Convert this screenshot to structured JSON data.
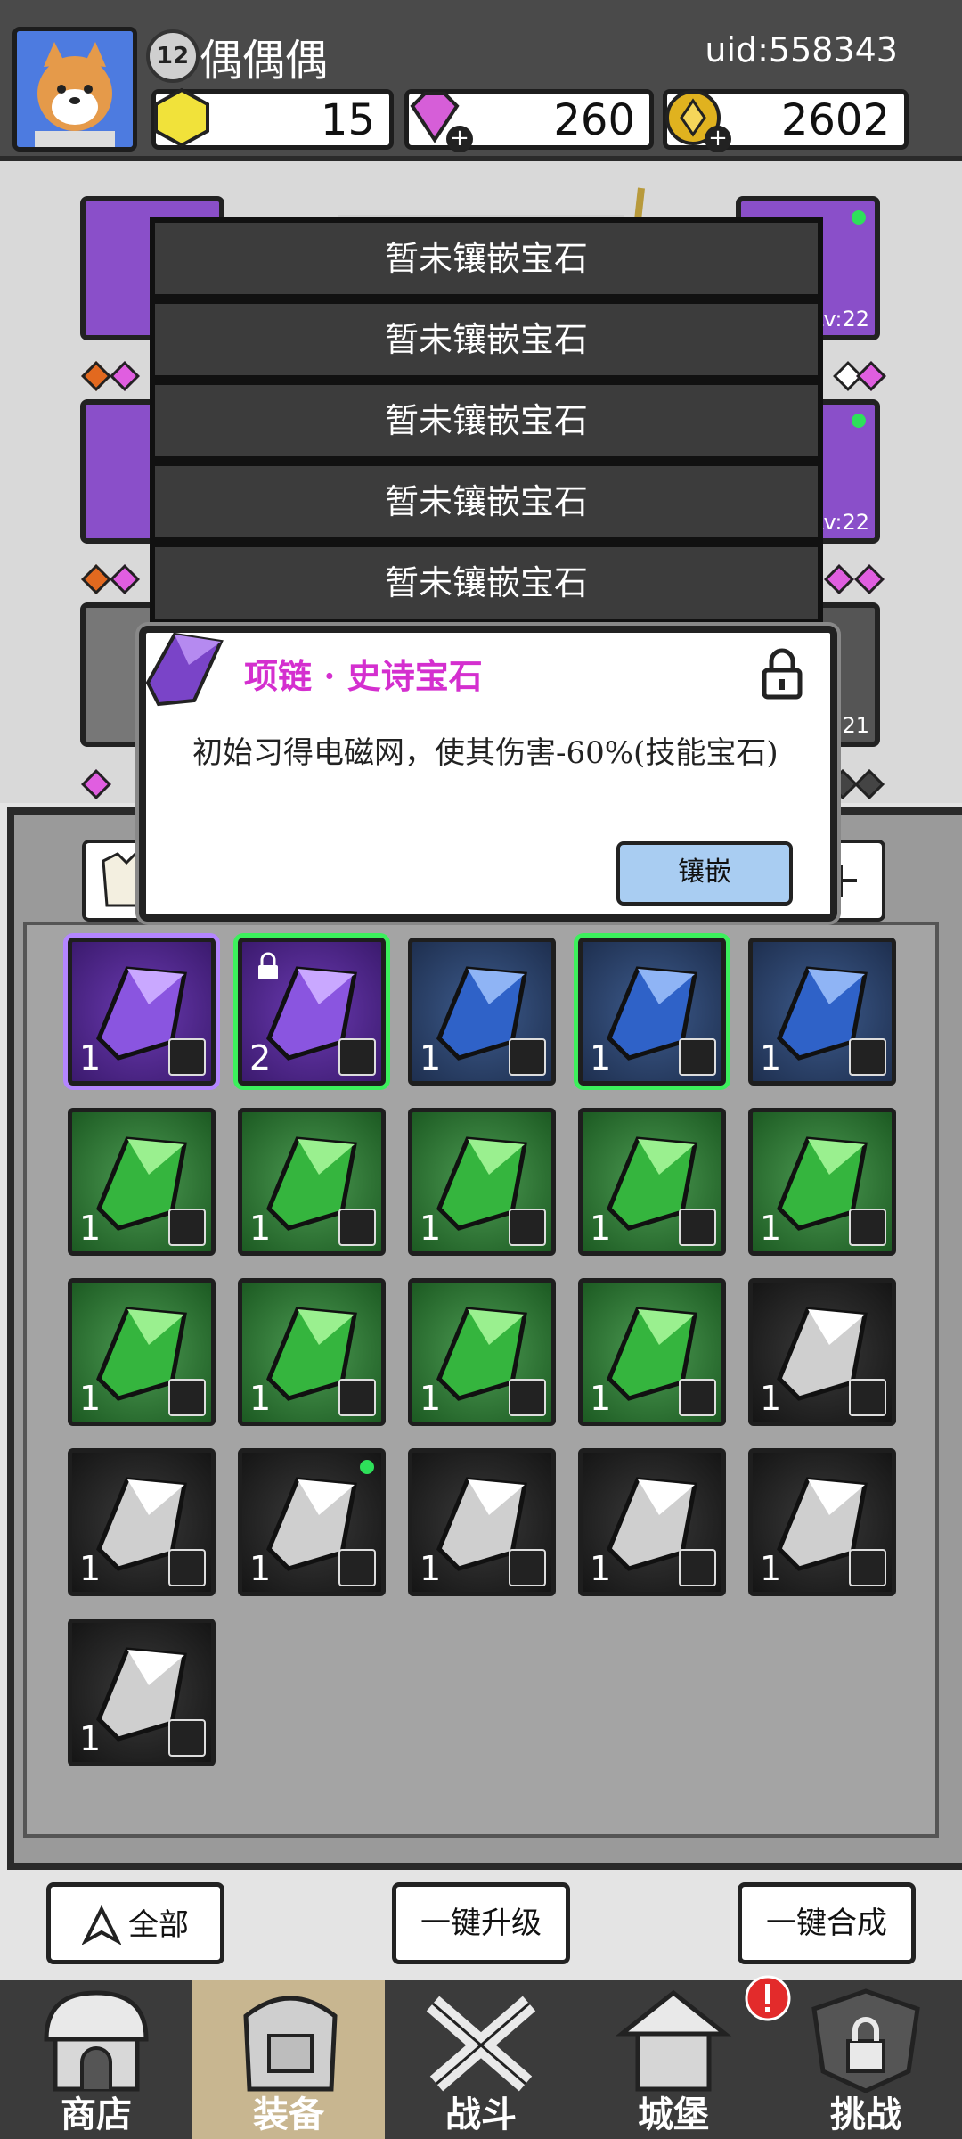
{
  "header": {
    "level": "12",
    "player_name": "偶偶偶",
    "uid": "uid:558343",
    "currencies": [
      {
        "name": "gold-gem",
        "value": "15",
        "color": "#f1e23a"
      },
      {
        "name": "diamond",
        "value": "260",
        "color": "#d65ed8"
      },
      {
        "name": "coin",
        "value": "2602",
        "color": "#e0b21f"
      }
    ]
  },
  "equipment": {
    "slot_levels": [
      "Lv:22",
      "Lv:22",
      "Lv:21"
    ],
    "socket_bars": [
      "暂未镶嵌宝石",
      "暂未镶嵌宝石",
      "暂未镶嵌宝石",
      "暂未镶嵌宝石",
      "暂未镶嵌宝石"
    ]
  },
  "popup": {
    "title": "项链 · 史诗宝石",
    "description": "初始习得电磁网，使其伤害-60%(技能宝石)",
    "button_label": "镶嵌"
  },
  "inventory": {
    "items": [
      {
        "color": "purple",
        "qty": "1",
        "type": "weapon-icon",
        "selected": "purple"
      },
      {
        "color": "purple",
        "qty": "2",
        "type": "necklace-icon",
        "selected": "green",
        "locked": true
      },
      {
        "color": "blue",
        "qty": "1",
        "type": "ring-icon"
      },
      {
        "color": "blue",
        "qty": "1",
        "type": "boots-icon",
        "selected": "green"
      },
      {
        "color": "blue",
        "qty": "1",
        "type": "boots-icon"
      },
      {
        "color": "green",
        "qty": "1",
        "type": "ring-icon"
      },
      {
        "color": "green",
        "qty": "1",
        "type": "armor-icon"
      },
      {
        "color": "green",
        "qty": "1",
        "type": "armor-icon"
      },
      {
        "color": "green",
        "qty": "1",
        "type": "boots-icon"
      },
      {
        "color": "green",
        "qty": "1",
        "type": "boots-icon"
      },
      {
        "color": "green",
        "qty": "1",
        "type": "helmet-icon"
      },
      {
        "color": "green",
        "qty": "1",
        "type": "helmet-icon"
      },
      {
        "color": "green",
        "qty": "1",
        "type": "helmet-icon"
      },
      {
        "color": "green",
        "qty": "1",
        "type": "helmet-icon"
      },
      {
        "color": "gray",
        "qty": "1",
        "type": "boots-icon"
      },
      {
        "color": "gray",
        "qty": "1",
        "type": "weapon-icon"
      },
      {
        "color": "gray",
        "qty": "1",
        "type": "helmet-icon",
        "dot": true
      },
      {
        "color": "gray",
        "qty": "1",
        "type": "helmet-icon"
      },
      {
        "color": "gray",
        "qty": "1",
        "type": "necklace-icon"
      },
      {
        "color": "gray",
        "qty": "1",
        "type": "necklace-icon"
      },
      {
        "color": "gray",
        "qty": "1",
        "type": "necklace-icon"
      }
    ]
  },
  "actions": {
    "filter_label": "全部",
    "upgrade_label": "一键升级",
    "merge_label": "一键合成"
  },
  "nav": {
    "items": [
      "商店",
      "装备",
      "战斗",
      "城堡",
      "挑战"
    ]
  }
}
